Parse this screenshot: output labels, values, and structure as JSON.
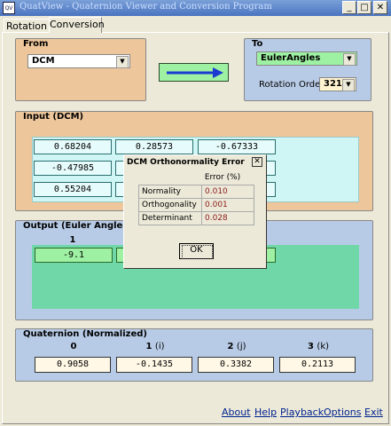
{
  "window": {
    "title": "QuatView - Quaternion Viewer and Conversion Program",
    "icon_label": "QV"
  },
  "tabs": [
    {
      "label": "Rotation"
    },
    {
      "label": "Conversion"
    }
  ],
  "from": {
    "title": "From",
    "value": "DCM"
  },
  "to": {
    "title": "To",
    "value": "EulerAngles",
    "rotation_order_label": "Rotation Order",
    "rotation_order_value": "321"
  },
  "input": {
    "title": "Input (DCM)",
    "rows": [
      [
        "0.68204",
        "0.28573",
        "-0.67333"
      ],
      [
        "-0.47985",
        "",
        ""
      ],
      [
        "0.55204",
        "",
        ""
      ]
    ]
  },
  "output": {
    "title": "Output (Euler Angles)",
    "headers": [
      "1"
    ],
    "values": [
      "-9.1",
      "",
      ""
    ]
  },
  "quaternion": {
    "title": "Quaternion (Normalized)",
    "headers": [
      {
        "num": "0",
        "sub": ""
      },
      {
        "num": "1",
        "sub": "(i)"
      },
      {
        "num": "2",
        "sub": "(j)"
      },
      {
        "num": "3",
        "sub": "(k)"
      }
    ],
    "values": [
      "0.9058",
      "-0.1435",
      "0.3382",
      "0.2113"
    ]
  },
  "dialog": {
    "title": "DCM Orthonormality Error",
    "column_header": "Error (%)",
    "rows": [
      {
        "label": "Normality",
        "value": "0.010"
      },
      {
        "label": "Orthogonality",
        "value": "0.001"
      },
      {
        "label": "Determinant",
        "value": "0.028"
      }
    ],
    "ok_label": "OK"
  },
  "footer": {
    "links": [
      "About",
      "Help",
      "Playback",
      "Options",
      "Exit"
    ]
  },
  "colors": {
    "orange_group": "#edc69b",
    "blue_group": "#b8cbe6",
    "output_green": "#70d8a8",
    "arrow_blue": "#1a3ad0"
  }
}
